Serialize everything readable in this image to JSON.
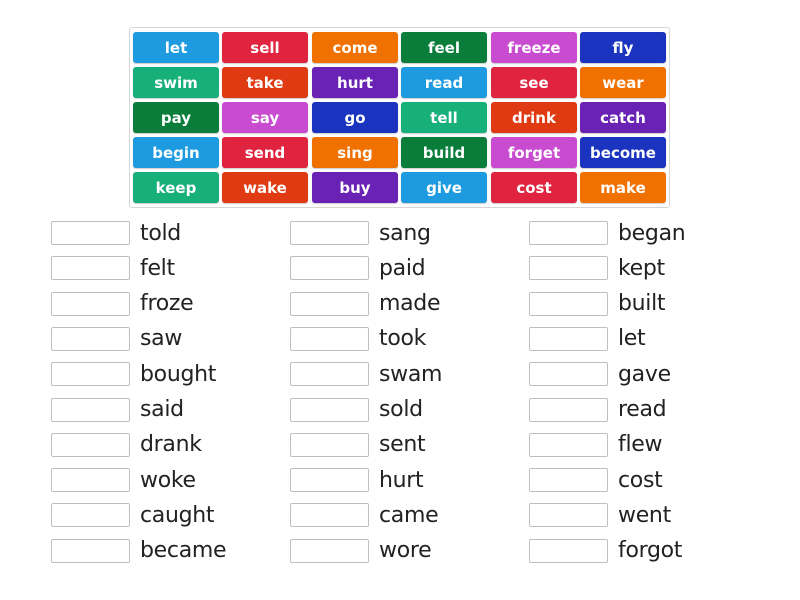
{
  "colors": {
    "blue": "#1e9be0",
    "red": "#e0243f",
    "orange": "#f07000",
    "darkgreen": "#0a7d3b",
    "magenta": "#c84bd0",
    "navy": "#1a34c0",
    "teal": "#17b07a",
    "redorange": "#e03a12",
    "purple": "#6a22b5"
  },
  "tiles": [
    {
      "label": "let",
      "color": "blue"
    },
    {
      "label": "sell",
      "color": "red"
    },
    {
      "label": "come",
      "color": "orange"
    },
    {
      "label": "feel",
      "color": "darkgreen"
    },
    {
      "label": "freeze",
      "color": "magenta"
    },
    {
      "label": "fly",
      "color": "navy"
    },
    {
      "label": "swim",
      "color": "teal"
    },
    {
      "label": "take",
      "color": "redorange"
    },
    {
      "label": "hurt",
      "color": "purple"
    },
    {
      "label": "read",
      "color": "blue"
    },
    {
      "label": "see",
      "color": "red"
    },
    {
      "label": "wear",
      "color": "orange"
    },
    {
      "label": "pay",
      "color": "darkgreen"
    },
    {
      "label": "say",
      "color": "magenta"
    },
    {
      "label": "go",
      "color": "navy"
    },
    {
      "label": "tell",
      "color": "teal"
    },
    {
      "label": "drink",
      "color": "redorange"
    },
    {
      "label": "catch",
      "color": "purple"
    },
    {
      "label": "begin",
      "color": "blue"
    },
    {
      "label": "send",
      "color": "red"
    },
    {
      "label": "sing",
      "color": "orange"
    },
    {
      "label": "build",
      "color": "darkgreen"
    },
    {
      "label": "forget",
      "color": "magenta"
    },
    {
      "label": "become",
      "color": "navy"
    },
    {
      "label": "keep",
      "color": "teal"
    },
    {
      "label": "wake",
      "color": "redorange"
    },
    {
      "label": "buy",
      "color": "purple"
    },
    {
      "label": "give",
      "color": "blue"
    },
    {
      "label": "cost",
      "color": "red"
    },
    {
      "label": "make",
      "color": "orange"
    }
  ],
  "answers": [
    [
      "told",
      "felt",
      "froze",
      "saw",
      "bought",
      "said",
      "drank",
      "woke",
      "caught",
      "became"
    ],
    [
      "sang",
      "paid",
      "made",
      "took",
      "swam",
      "sold",
      "sent",
      "hurt",
      "came",
      "wore"
    ],
    [
      "began",
      "kept",
      "built",
      "let",
      "gave",
      "read",
      "flew",
      "cost",
      "went",
      "forgot"
    ]
  ]
}
